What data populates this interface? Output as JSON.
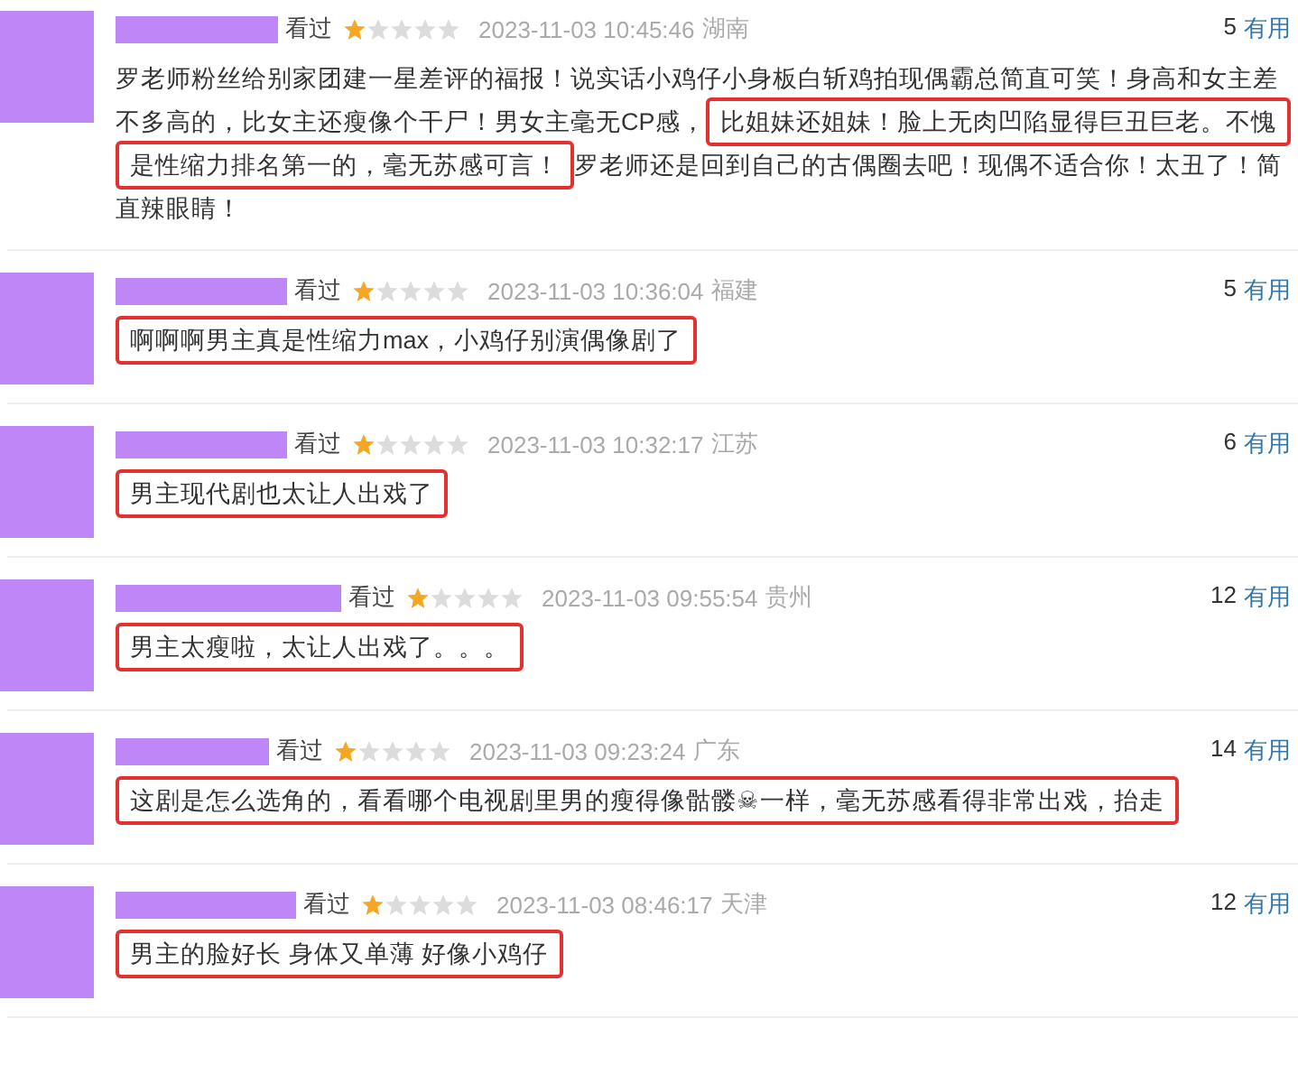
{
  "comments": [
    {
      "status": "看过",
      "stars": 1,
      "time": "2023-11-03 10:45:46",
      "location": "湖南",
      "votes": "5",
      "vote_label": "有用",
      "body": [
        {
          "text": "罗老师粉丝给别家团建一星差评的福报！说实话小鸡仔小身板白斩鸡拍现偶霸总简直可笑！身高和女主差不多高的，比女主还瘦像个干尸！男女主毫无CP感，",
          "highlighted": false
        },
        {
          "text": "比姐妹还姐妹！脸上无肉凹陷显得巨丑巨老。不愧是性缩力排名第一的，毫无苏感可言！",
          "highlighted": true
        },
        {
          "text": "罗老师还是回到自己的古偶圈去吧！现偶不适合你！太丑了！简直辣眼睛！",
          "highlighted": false
        }
      ]
    },
    {
      "status": "看过",
      "stars": 1,
      "time": "2023-11-03 10:36:04",
      "location": "福建",
      "votes": "5",
      "vote_label": "有用",
      "body": [
        {
          "text": "啊啊啊男主真是性缩力max，小鸡仔别演偶像剧了",
          "highlighted": true
        }
      ]
    },
    {
      "status": "看过",
      "stars": 1,
      "time": "2023-11-03 10:32:17",
      "location": "江苏",
      "votes": "6",
      "vote_label": "有用",
      "body": [
        {
          "text": "男主现代剧也太让人出戏了",
          "highlighted": true
        }
      ]
    },
    {
      "status": "看过",
      "stars": 1,
      "time": "2023-11-03 09:55:54",
      "location": "贵州",
      "votes": "12",
      "vote_label": "有用",
      "body": [
        {
          "text": "男主太瘦啦，太让人出戏了。。。",
          "highlighted": true
        }
      ]
    },
    {
      "status": "看过",
      "stars": 1,
      "time": "2023-11-03 09:23:24",
      "location": "广东",
      "votes": "14",
      "vote_label": "有用",
      "body": [
        {
          "text": "这剧是怎么选角的，看看哪个电视剧里男的瘦得像骷髅☠一样，毫无苏感看得非常出戏，抬走",
          "highlighted": true
        }
      ]
    },
    {
      "status": "看过",
      "stars": 1,
      "time": "2023-11-03 08:46:17",
      "location": "天津",
      "votes": "12",
      "vote_label": "有用",
      "body": [
        {
          "text": "男主的脸好长 身体又单薄 好像小鸡仔",
          "highlighted": true
        }
      ]
    }
  ]
}
